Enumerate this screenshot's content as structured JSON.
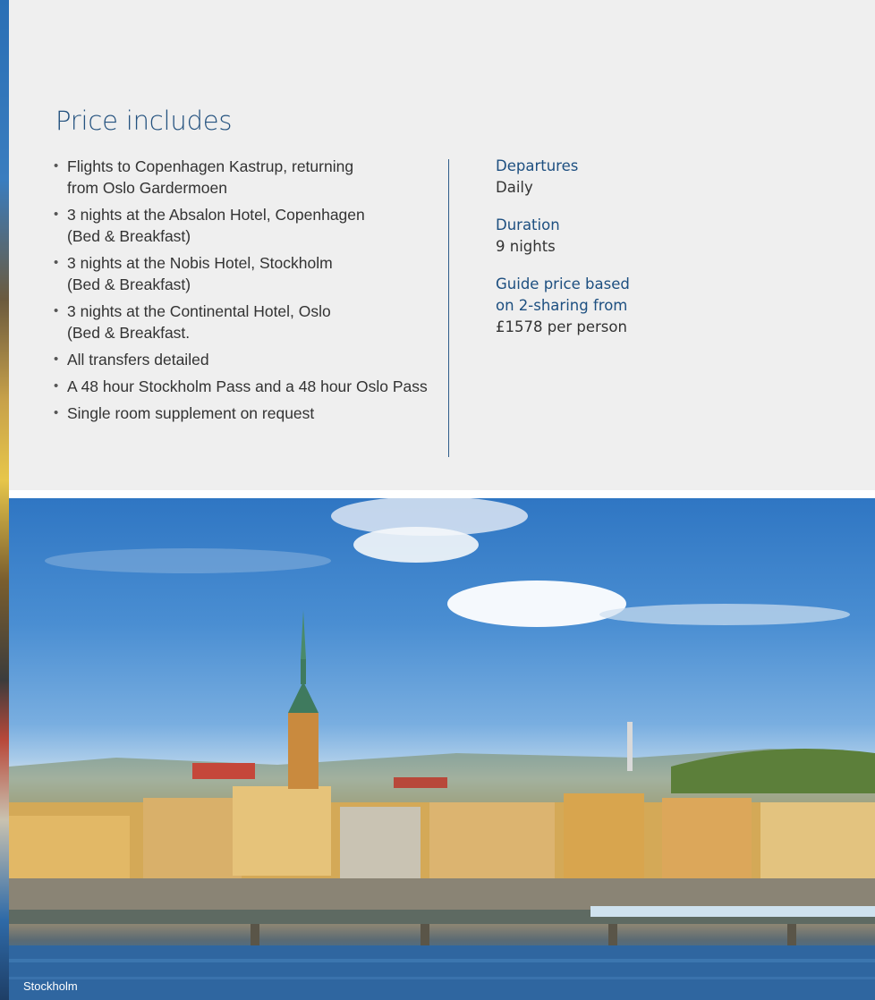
{
  "section": {
    "heading": "Price includes",
    "includes": [
      "Flights to Copenhagen Kastrup, returning\nfrom Oslo Gardermoen",
      "3 nights at the Absalon Hotel, Copenhagen\n(Bed & Breakfast)",
      "3 nights at the Nobis Hotel, Stockholm\n(Bed & Breakfast)",
      "3 nights at the Continental Hotel, Oslo\n(Bed & Breakfast.",
      "All transfers detailed",
      "A 48 hour Stockholm Pass and a 48 hour Oslo Pass",
      "Single room supplement on request"
    ]
  },
  "info": {
    "departures_label": "Departures",
    "departures_value": "Daily",
    "duration_label": "Duration",
    "duration_value": "9 nights",
    "price_label": "Guide price based\non 2-sharing from",
    "price_value": "£1578 per person"
  },
  "photo": {
    "caption": "Stockholm"
  },
  "colors": {
    "heading": "#24527f",
    "label": "#1d4f80",
    "panel_bg": "#efefef",
    "divider": "#2f5c8a"
  }
}
